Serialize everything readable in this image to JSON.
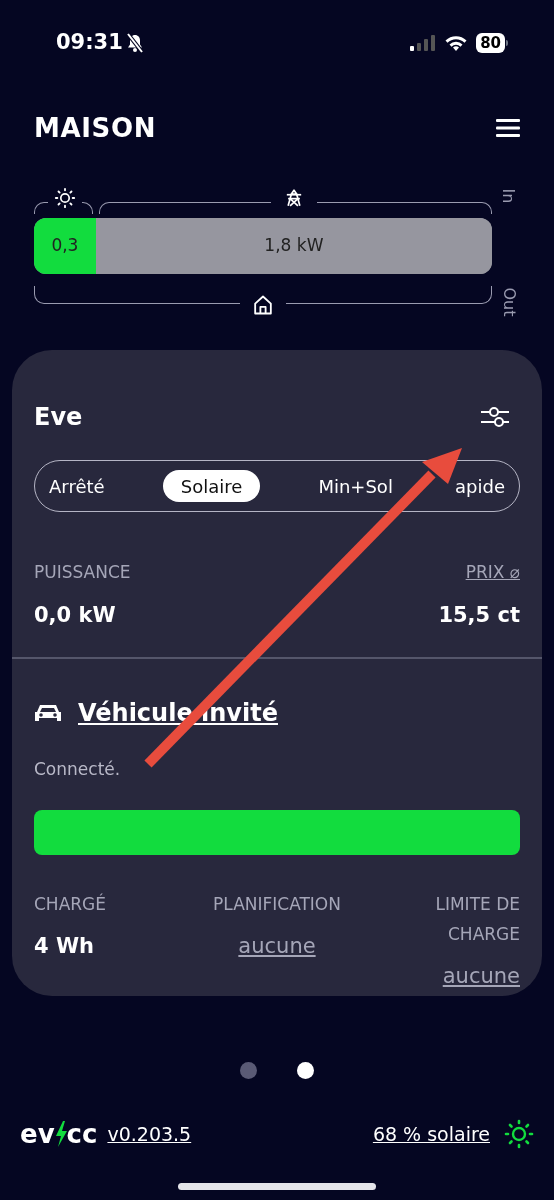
{
  "status_bar": {
    "time": "09:31",
    "battery": "80"
  },
  "header": {
    "title": "MAISON"
  },
  "energy_flow": {
    "in_label": "In",
    "out_label": "Out",
    "segments": [
      {
        "kind": "solar",
        "value": "0,3",
        "level": 0.135
      },
      {
        "kind": "grid",
        "value": "1,8 kW",
        "level": 0.865
      }
    ]
  },
  "loadpoint": {
    "title": "Eve",
    "modes": [
      {
        "label": "Arrêté",
        "selected": false
      },
      {
        "label": "Solaire",
        "selected": true
      },
      {
        "label": "Min+Sol",
        "selected": false
      },
      {
        "label": "apide",
        "selected": false
      }
    ],
    "power": {
      "label": "PUISSANCE",
      "value": "0,0 kW"
    },
    "price": {
      "label": "PRIX ⌀",
      "value": "15,5 ct"
    },
    "vehicle": {
      "name": "Véhicule invité",
      "status": "Connecté."
    },
    "stats": [
      {
        "label": "CHARGÉ",
        "value": "4 Wh",
        "kind": "plain"
      },
      {
        "label": "PLANIFICATION",
        "value": "aucune",
        "kind": "link"
      },
      {
        "label": "LIMITE DE CHARGE",
        "value": "aucune",
        "kind": "link"
      }
    ]
  },
  "pager": [
    {
      "selected": false
    },
    {
      "selected": true
    }
  ],
  "footer": {
    "logo_left": "ev",
    "logo_right": "cc",
    "version": "v0.203.5",
    "solar_share": "68 % solaire"
  }
}
